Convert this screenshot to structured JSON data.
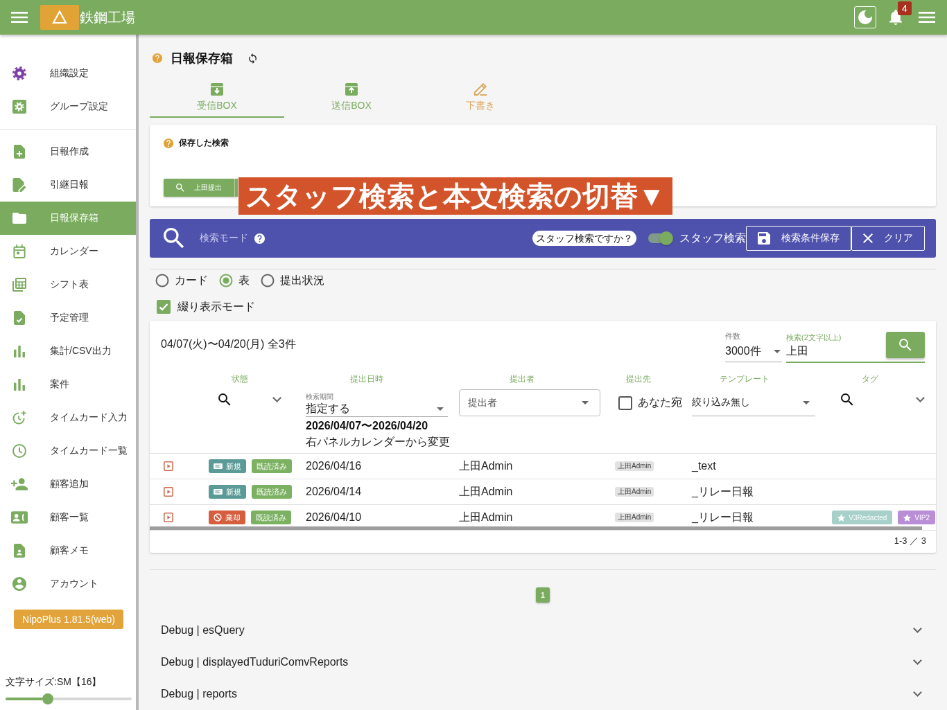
{
  "top_bar": {
    "company": "鉄鋼工場",
    "notification_count": "4"
  },
  "sidebar": {
    "sections": [
      {
        "items": [
          {
            "label": "組織設定",
            "selected": false
          },
          {
            "label": "グループ設定",
            "selected": false
          }
        ]
      },
      {
        "items": [
          {
            "label": "日報作成",
            "selected": false
          },
          {
            "label": "引継日報",
            "selected": false
          },
          {
            "label": "日報保存箱",
            "selected": true
          },
          {
            "label": "カレンダー",
            "selected": false
          },
          {
            "label": "シフト表",
            "selected": false
          },
          {
            "label": "予定管理",
            "selected": false
          },
          {
            "label": "集計/CSV出力",
            "selected": false
          },
          {
            "label": "案件",
            "selected": false
          },
          {
            "label": "タイムカード入力",
            "selected": false
          },
          {
            "label": "タイムカード一覧",
            "selected": false
          },
          {
            "label": "顧客追加",
            "selected": false
          },
          {
            "label": "顧客一覧",
            "selected": false
          },
          {
            "label": "顧客メモ",
            "selected": false
          },
          {
            "label": "アカウント",
            "selected": false
          }
        ]
      }
    ],
    "version_button": "NipoPlus 1.81.5(web)",
    "font_size": {
      "label": "文字サイズ:SM【16】",
      "level": 0.335
    }
  },
  "page": {
    "title": "日報保存箱"
  },
  "tabs": [
    {
      "label": "受信BOX",
      "selected": true,
      "color": "#7aab5f"
    },
    {
      "label": "送信BOX",
      "selected": false,
      "color": "#7aab5f"
    },
    {
      "label": "下書き",
      "selected": false,
      "color": "#dba75c"
    }
  ],
  "saved_searches": {
    "title": "保存した検索",
    "chips": [
      {
        "label": "上田提出"
      }
    ]
  },
  "overlay_caption": "スタッフ検索と本文検索の切替▼",
  "search_bar": {
    "mode_label": "検索モード",
    "hint_pill": "スタッフ検索ですか？",
    "toggle": {
      "label": "スタッフ検索",
      "on": true
    },
    "buttons": [
      {
        "label": "検索条件保存",
        "kind": "save"
      },
      {
        "label": "クリア",
        "kind": "clear"
      }
    ]
  },
  "view_modes": [
    {
      "label": "カード",
      "selected": false
    },
    {
      "label": "表",
      "selected": true
    },
    {
      "label": "提出状況",
      "selected": false
    }
  ],
  "tuduri_mode": {
    "label": "綴り表示モード",
    "checked": true
  },
  "table": {
    "range": "04/07(火)〜04/20(月) 全3件",
    "count_select": {
      "label": "件数",
      "value": "3000件"
    },
    "search_field": {
      "label": "検索(2文字以上)",
      "value": "上田"
    },
    "columns": [
      "状態",
      "提出日時",
      "提出者",
      "提出先",
      "テンプレート",
      "タグ"
    ],
    "filters": {
      "period": {
        "label": "検索期間",
        "value": "指定する",
        "range": "2026/04/07〜2026/04/20",
        "note": "右パネルカレンダーから変更"
      },
      "submitter": {
        "label": "提出者"
      },
      "recipient": {
        "label": "あなた宛",
        "checked": false
      },
      "template": {
        "value": "絞り込み無し"
      }
    },
    "rows": [
      {
        "badges": [
          {
            "label": "新規",
            "kind": "new"
          },
          {
            "label": "既読済み",
            "kind": "read"
          }
        ],
        "date": "2026/04/16",
        "submitter": "上田Admin",
        "recipient": "上田Admin",
        "template": "_text"
      },
      {
        "badges": [
          {
            "label": "新規",
            "kind": "new"
          },
          {
            "label": "既読済み",
            "kind": "read"
          }
        ],
        "date": "2026/04/14",
        "submitter": "上田Admin",
        "recipient": "上田Admin",
        "template": "_リレー日報"
      },
      {
        "badges": [
          {
            "label": "棄却",
            "kind": "rejected"
          },
          {
            "label": "既読済み",
            "kind": "read"
          }
        ],
        "date": "2026/04/10",
        "submitter": "上田Admin",
        "recipient": "上田Admin",
        "template": "_リレー日報",
        "tags": [
          {
            "label": "V3Redacted",
            "color": "#a6d0c9"
          },
          {
            "label": "VIP2",
            "color": "#b98ed6"
          }
        ]
      }
    ],
    "footer": "1-3 ／ 3"
  },
  "pagination": [
    {
      "label": "1",
      "selected": true
    }
  ],
  "debug_panels": [
    {
      "title": "Debug | esQuery",
      "expanded": false
    },
    {
      "title": "Debug | displayedTuduriComvReports",
      "expanded": false
    },
    {
      "title": "Debug | reports",
      "expanded": false
    }
  ]
}
